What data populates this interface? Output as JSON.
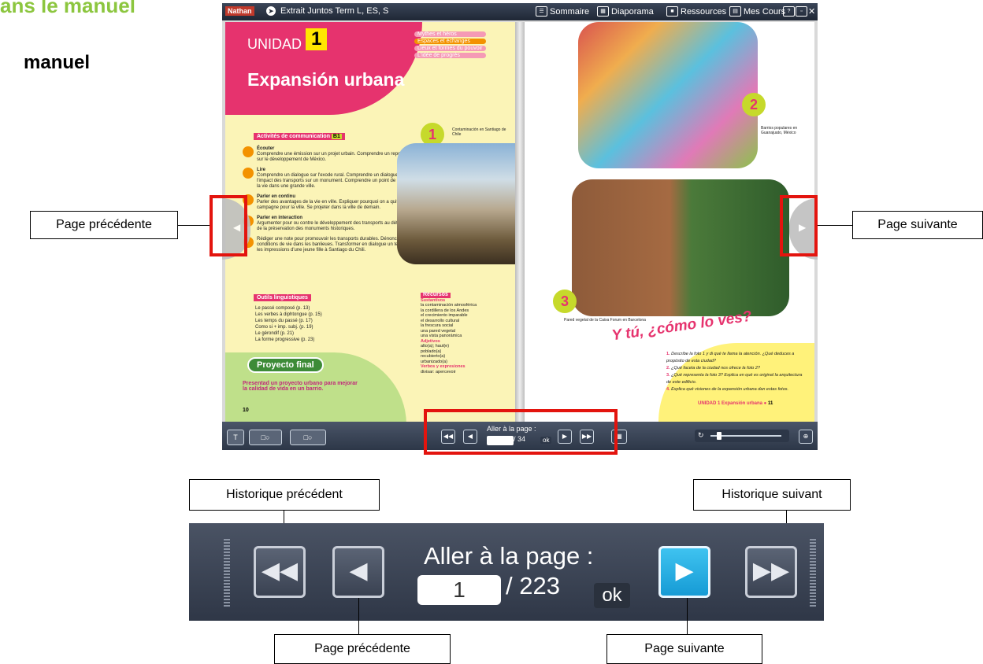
{
  "heading": {
    "green": "ans le manuel",
    "black": "manuel"
  },
  "viewer": {
    "brand": "Nathan",
    "doc_title": "Extrait Juntos Term L, ES, S",
    "menu": {
      "sommaire": "Sommaire",
      "diaporama": "Diaporama",
      "ressources": "Ressources",
      "mes_cours": "Mes Cours",
      "help": "?"
    },
    "left_page": {
      "unidad": "UNIDAD",
      "unidad_num": "1",
      "title": "Expansión urbana",
      "tags": [
        "Mythes et héros",
        "Espaces et échanges",
        "Lieux et formes du pouvoir",
        "L'idée de progrès"
      ],
      "activities_title": "Activités de communication",
      "activities_level": "B1",
      "activities": [
        {
          "title": "Écouter",
          "text": "Comprendre une émission sur un projet urbain. Comprendre un reportage sur le développement de México."
        },
        {
          "title": "Lire",
          "text": "Comprendre un dialogue sur l'exode rural. Comprendre un dialogue sur l'impact des transports sur un monument. Comprendre un point de vue sur la vie dans une grande ville."
        },
        {
          "title": "Parler en continu",
          "text": "Parler des avantages de la vie en ville. Expliquer pourquoi on a quitté la campagne pour la ville. Se projeter dans la ville de demain."
        },
        {
          "title": "Parler en interaction",
          "text": "Argumenter pour ou contre le développement des transports au détriment de la préservation des monuments historiques."
        },
        {
          "title": "",
          "text": "Rédiger une note pour promouvoir les transports durables. Dénoncer les conditions de vie dans les banlieues. Transformer en dialogue un texte sur les impressions d'une jeune fille à Santiago du Chili."
        }
      ],
      "outils_title": "Outils linguistiques",
      "outils": [
        "Le passé composé (p. 13)",
        "Les verbes à diphtongue (p. 15)",
        "Les temps du passé (p. 17)",
        "Como si + imp. subj. (p. 19)",
        "Le gérondif (p. 21)",
        "La forme progressive (p. 23)"
      ],
      "proyecto_label": "Proyecto final",
      "proyecto_text": "Presentad un proyecto urbano para mejorar la calidad de vida en un barrio.",
      "page_number": "10",
      "photo1_badge": "1",
      "photo1_caption": "Contaminación en Santiago de Chile",
      "recursos_title": "Recursos",
      "recursos_sustantivos_title": "Sustantivos",
      "recursos_sustantivos": [
        "la contaminación atmosférica",
        "la cordillera de los Andes",
        "el crecimiento imparable",
        "el desarrollo cultural",
        "la frescura social",
        "una pared vegetal",
        "una vista panorámica"
      ],
      "recursos_adjetivos_title": "Adjetivos",
      "recursos_adjetivos": [
        "alto(a); haut(e)",
        "poblado(a)",
        "recubierto(a)",
        "urbanizado(a)"
      ],
      "recursos_verbos_title": "Verbos y expresiones",
      "recursos_verbos": [
        "divisar: apercevoir"
      ]
    },
    "right_page": {
      "photo2_badge": "2",
      "photo2_caption": "Barrios populares en Guanajuato, México",
      "photo3_badge": "3",
      "photo3_caption": "Pared vegetal de la Caixa Forum en Barcelona",
      "como_title": "Y tú, ¿cómo lo ves?",
      "questions": [
        {
          "n": "1.",
          "text": "Describe la foto 1 y di qué te llama la atención. ¿Qué deduces a propósito de esta ciudad?"
        },
        {
          "n": "2.",
          "text": "¿Qué faceta de la ciudad nos ofrece la foto 2?"
        },
        {
          "n": "3.",
          "text": "¿Qué representa la foto 3? Explica en qué es original la arquitectura de este edificio."
        },
        {
          "n": "4.",
          "text": "Explica qué visiones de la expansión urbana dan estas fotos."
        }
      ],
      "footer": "UNIDAD 1 Expansión urbana",
      "page_number": "11"
    },
    "bottombar": {
      "aller_label": "Aller à la page :",
      "page_value": "",
      "page_total": "/ 34",
      "ok": "ok"
    }
  },
  "annotations": {
    "page_precedente_top": "Page  précédente",
    "page_suivante_top": "Page  suivante",
    "historique_precedent": "Historique précédent",
    "historique_suivant": "Historique suivant",
    "page_precedente_bottom": "Page  précédente",
    "page_suivante_bottom": "Page suivante"
  },
  "zoomed_bar": {
    "aller_label": "Aller à la page :",
    "page_value": "1",
    "page_total": "/ 223",
    "ok": "ok"
  },
  "colors": {
    "accent_red": "#e3140e",
    "pink": "#e6336e",
    "green_heading": "#8cc63f",
    "active_blue": "#169bd5"
  }
}
